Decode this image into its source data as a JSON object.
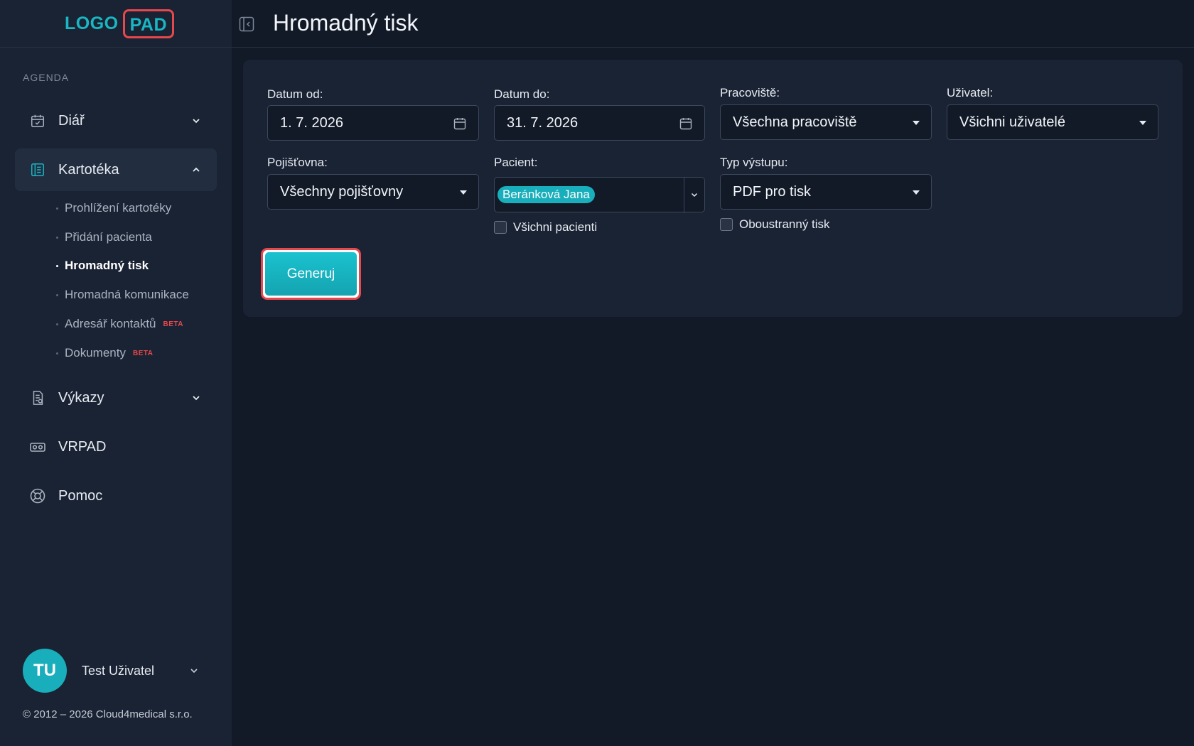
{
  "logo": {
    "left": "LOGO",
    "right": "PAD"
  },
  "sidebar": {
    "section": "AGENDA",
    "items": [
      {
        "label": "Diář"
      },
      {
        "label": "Kartotéka"
      },
      {
        "label": "Výkazy"
      },
      {
        "label": "VRPAD"
      },
      {
        "label": "Pomoc"
      }
    ],
    "subitems": [
      {
        "label": "Prohlížení kartotéky"
      },
      {
        "label": "Přidání pacienta"
      },
      {
        "label": "Hromadný tisk"
      },
      {
        "label": "Hromadná komunikace"
      },
      {
        "label": "Adresář kontaktů",
        "badge": "BETA"
      },
      {
        "label": "Dokumenty",
        "badge": "BETA"
      }
    ]
  },
  "user": {
    "initials": "TU",
    "name": "Test Uživatel"
  },
  "copyright": "© 2012 – 2026 Cloud4medical s.r.o.",
  "header": {
    "title": "Hromadný tisk"
  },
  "form": {
    "date_from": {
      "label": "Datum od:",
      "value": "1. 7. 2026"
    },
    "date_to": {
      "label": "Datum do:",
      "value": "31. 7. 2026"
    },
    "workplace": {
      "label": "Pracoviště:",
      "value": "Všechna pracoviště"
    },
    "user": {
      "label": "Uživatel:",
      "value": "Všichni uživatelé"
    },
    "insurer": {
      "label": "Pojišťovna:",
      "value": "Všechny pojišťovny"
    },
    "patient": {
      "label": "Pacient:",
      "tag": "Beránková Jana",
      "all_label": "Všichni pacienti"
    },
    "output": {
      "label": "Typ výstupu:",
      "value": "PDF pro tisk",
      "duplex_label": "Oboustranný tisk"
    },
    "generate": "Generuj"
  },
  "colors": {
    "accent": "#19aebb",
    "highlight": "#e5484d",
    "background": "#121a27",
    "panel": "#1a2333"
  }
}
